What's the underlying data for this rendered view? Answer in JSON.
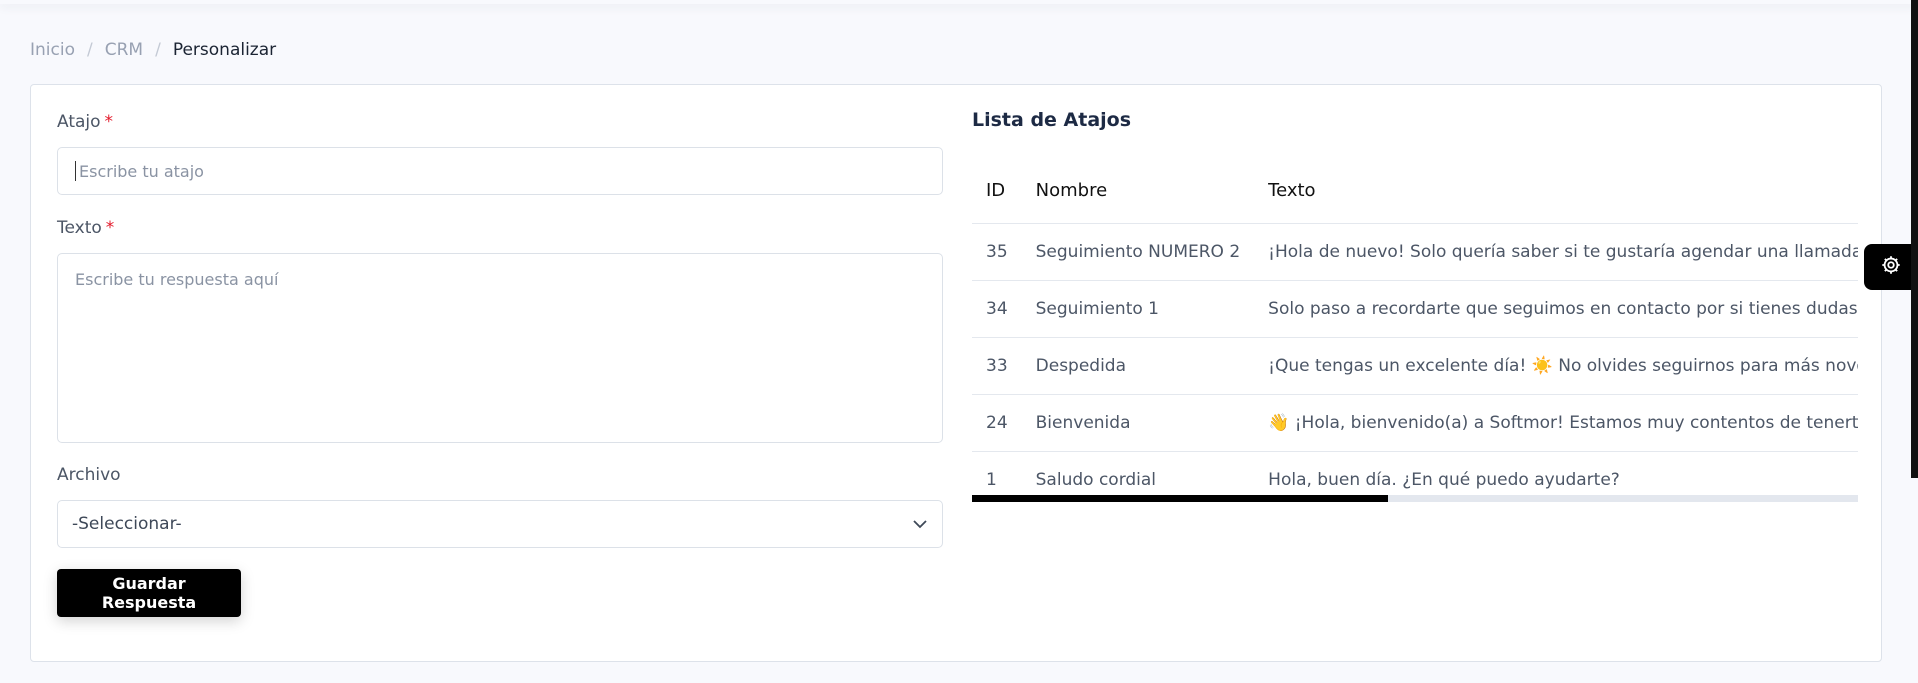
{
  "breadcrumb": {
    "home": "Inicio",
    "section": "CRM",
    "current": "Personalizar",
    "separator": "/"
  },
  "form": {
    "atajo_label": "Atajo",
    "atajo_placeholder": "Escribe tu atajo",
    "texto_label": "Texto",
    "texto_placeholder": "Escribe tu respuesta aquí",
    "required_mark": "*",
    "archivo_label": "Archivo",
    "archivo_selected": "-Seleccionar-",
    "save_label": "Guardar Respuesta"
  },
  "shortcuts": {
    "title": "Lista de Atajos",
    "headers": [
      "ID",
      "Nombre",
      "Texto"
    ],
    "rows": [
      {
        "id": "35",
        "nombre": "Seguimiento NUMERO 2",
        "texto": "¡Hola de nuevo! Solo quería saber si te gustaría agendar una llamada o visita"
      },
      {
        "id": "34",
        "nombre": "Seguimiento 1",
        "texto": "Solo paso a recordarte que seguimos en contacto por si tienes dudas o deseas"
      },
      {
        "id": "33",
        "nombre": "Despedida",
        "texto": "¡Que tengas un excelente día! ☀️ No olvides seguirnos para más novedades."
      },
      {
        "id": "24",
        "nombre": "Bienvenida",
        "texto": "👋 ¡Hola, bienvenido(a) a Softmor! Estamos muy contentos de tenerte por aquí"
      },
      {
        "id": "1",
        "nombre": "Saludo cordial",
        "texto": "Hola, buen día. ¿En qué puedo ayudarte?"
      }
    ],
    "horizontal_scroll_fraction": 0.47
  },
  "icons": {
    "settings": "gear-icon",
    "select_arrow": "chevron-down-icon"
  }
}
